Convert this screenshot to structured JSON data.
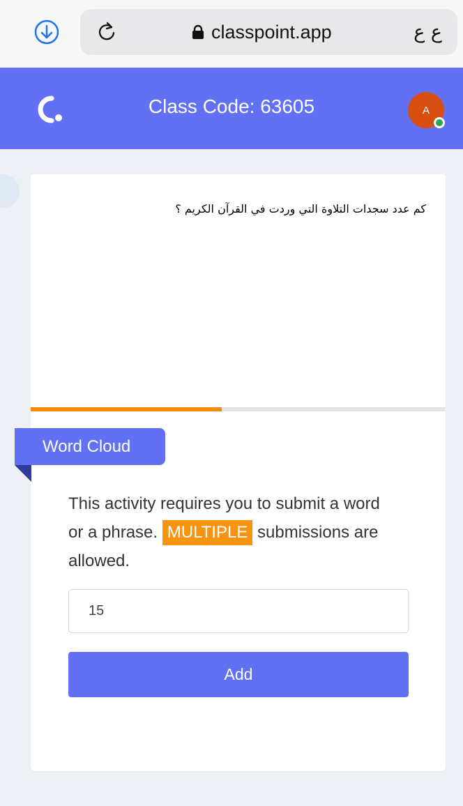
{
  "browser": {
    "url": "classpoint.app",
    "text_size_label": "ع ع"
  },
  "header": {
    "class_code": "Class Code: 63605",
    "avatar_initial": "A"
  },
  "slide": {
    "question": "كم عدد سجدات التلاوة التي وردت في القرآن الكريم ؟",
    "progress": 0.46
  },
  "activity": {
    "type_label": "Word Cloud",
    "instructions_before": "This activity requires you to submit a word or a phrase.",
    "badge": "MULTIPLE",
    "instructions_after": "submissions are allowed.",
    "input_value": "15",
    "add_label": "Add"
  },
  "colors": {
    "brand": "#6271f4",
    "accent": "#f8930f",
    "avatar": "#d94f12",
    "online": "#2ea44f"
  }
}
